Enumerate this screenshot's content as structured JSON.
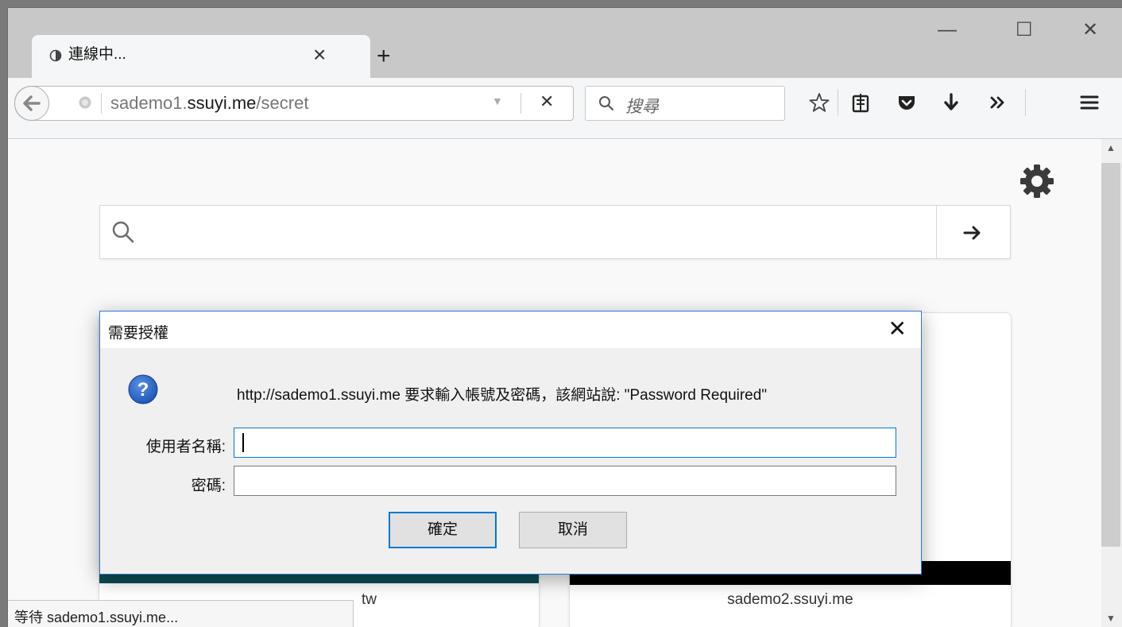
{
  "browser": {
    "tab": {
      "title": "連線中...",
      "close": "×"
    },
    "new_tab": "+",
    "window_controls": {
      "minimize": "—",
      "maximize": "☐",
      "close": "✕"
    },
    "url": {
      "prefix": "sademo1.",
      "host": "ssuyi.me",
      "path": "/secret"
    },
    "url_dropdown": "▼",
    "stop": "✕",
    "search_placeholder": "搜尋"
  },
  "page": {
    "tiles": [
      {
        "label": "tw"
      },
      {
        "label": "sademo2.ssuyi.me"
      }
    ],
    "status": "等待 sademo1.ssuyi.me..."
  },
  "dialog": {
    "title": "需要授權",
    "close": "✕",
    "message": "http://sademo1.ssuyi.me 要求輸入帳號及密碼，該網站說: \"Password Required\"",
    "username_label": "使用者名稱:",
    "password_label": "密碼:",
    "ok_label": "確定",
    "cancel_label": "取消"
  },
  "colors": {
    "accent": "#0078d7",
    "help_icon": "#1f58b7",
    "tile_thumb": "#0b4d55"
  }
}
